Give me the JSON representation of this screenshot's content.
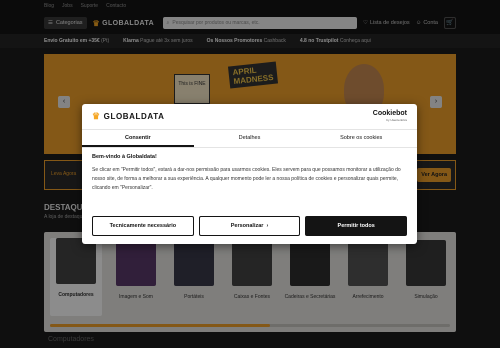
{
  "topbar": {
    "links": [
      "Blog",
      "Jobs",
      "Suporte",
      "Contacto"
    ]
  },
  "header": {
    "categories_label": "Categorias",
    "logo_text": "GLOBALDATA",
    "search_placeholder": "Pesquisar por produtos ou marcas, etc.",
    "wishlist_label": "Lista de desejos",
    "account_label": "Conta"
  },
  "perks": [
    {
      "bold": "Envio Gratuito em +35€",
      "rest": "(Pt)"
    },
    {
      "bold": "Klarna",
      "rest": "Pague até 3x sem juros"
    },
    {
      "bold": "Os Nossos Promotores",
      "rest": "Cashback"
    },
    {
      "bold": "4.8 no Trustpilot",
      "rest": "Conheça aqui"
    }
  ],
  "hero": {
    "title_line1": "APRIL",
    "title_line2": "MADNESS",
    "sign_text": "This is FINE"
  },
  "promo": {
    "text": "Leva Agora",
    "button": "Ver Agora"
  },
  "section": {
    "title": "DESTAQUES",
    "subtitle": "A loja de destaque das categorias"
  },
  "categories": [
    {
      "label": "Computadores"
    },
    {
      "label": "Imagem e Som"
    },
    {
      "label": "Portáteis"
    },
    {
      "label": "Caixas e Fontes"
    },
    {
      "label": "Cadeiras e Secretárias"
    },
    {
      "label": "Arrefecimento"
    },
    {
      "label": "Simulação"
    }
  ],
  "bottom_label": "Computadores",
  "dialog": {
    "logo_text": "GLOBALDATA",
    "cookiebot_title": "Cookiebot",
    "cookiebot_sub": "by Usercentrics",
    "tabs": [
      "Consentir",
      "Detalhes",
      "Sobre os cookies"
    ],
    "heading": "Bem-vindo à Globaldata!",
    "body": "Se clicar em \"Permitir todos\", estará a dar-nos permissão para usarmos cookies. Eles servem para que possamos monitorar a utilização do nosso site, de forma a melhorar a sua experiência. A qualquer momento pode ler a nossa política de cookies e personalizar quais permite, clicando em \"Personalizar\".",
    "btn_necessary": "Tecnicamente necessário",
    "btn_customize": "Personalizar",
    "btn_allow": "Permitir todos"
  },
  "colors": {
    "accent": "#f0a02a",
    "dark": "#141414",
    "dialog_bg": "#ffffff"
  }
}
